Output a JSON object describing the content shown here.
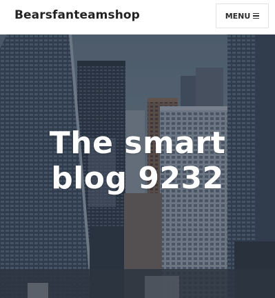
{
  "header": {
    "site_title": "Bearsfanteamshop",
    "menu_label": "MENU",
    "menu_icon": "hamburger-icon"
  },
  "hero": {
    "title_line1": "The smart",
    "title_line2": "blog 9232",
    "image": "city-skyline-skyscrapers"
  },
  "colors": {
    "title_text": "#232323",
    "hero_text": "#ffffff",
    "menu_border": "#e2e2e2",
    "sky": "#6e7e8d"
  }
}
